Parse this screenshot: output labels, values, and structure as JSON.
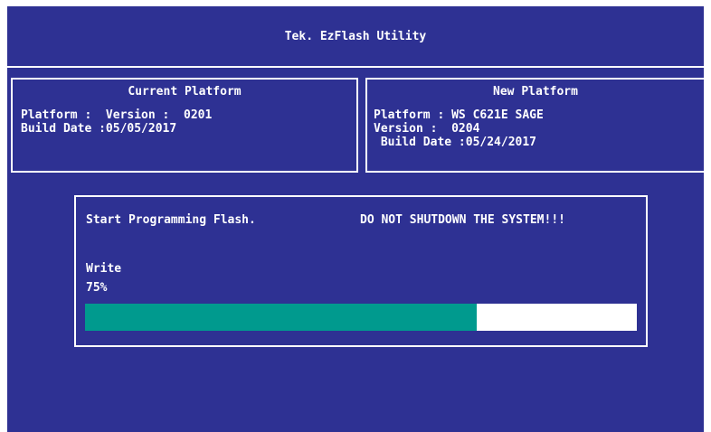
{
  "app": {
    "title": "Tek. EzFlash Utility"
  },
  "current_platform": {
    "heading": "Current Platform",
    "lines": [
      "Platform :  Version :  0201",
      "Build Date :05/05/2017"
    ]
  },
  "new_platform": {
    "heading": "New Platform",
    "lines": [
      "Platform : WS C621E SAGE",
      "Version :  0204",
      " Build Date :05/24/2017"
    ]
  },
  "progress": {
    "status": "Start Programming Flash.",
    "warning": "DO NOT SHUTDOWN THE SYSTEM!!!",
    "operation": "Write",
    "percent_label": "75%",
    "fraction": 0.71
  },
  "colors": {
    "background": "#2e3193",
    "progress_fill": "#009a8e",
    "progress_track": "#ffffff"
  }
}
